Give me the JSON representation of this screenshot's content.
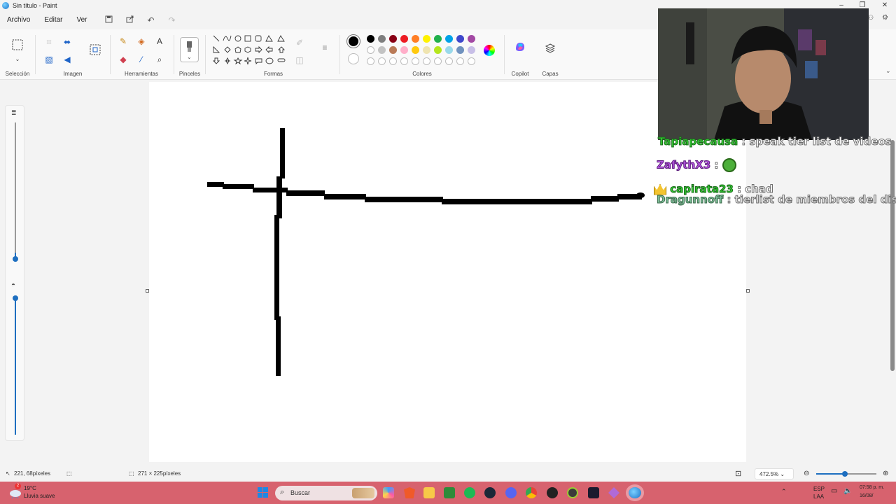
{
  "window": {
    "title": "Sin título - Paint"
  },
  "menu": {
    "items": [
      "Archivo",
      "Editar",
      "Ver"
    ]
  },
  "ribbon": {
    "groups": {
      "selection": "Selección",
      "image": "Imagen",
      "tools": "Herramientas",
      "brushes": "Pinceles",
      "shapes": "Formas",
      "colors": "Colores",
      "copilot": "Copilot",
      "layers": "Capas"
    },
    "palette_row1": [
      "#000000",
      "#7f7f7f",
      "#880015",
      "#ed1c24",
      "#ff7f27",
      "#fff200",
      "#22b14c",
      "#00a2e8",
      "#3f48cc",
      "#a349a4"
    ],
    "palette_row2": [
      "#ffffff",
      "#c3c3c3",
      "#b97a57",
      "#ffaec9",
      "#ffc90e",
      "#efe4b0",
      "#b5e61d",
      "#99d9ea",
      "#7092be",
      "#c8bfe7"
    ],
    "active_color": "#000000"
  },
  "chat": {
    "lines": [
      {
        "name": "Tapiapecausa",
        "msg": ": speak tier list de videos",
        "name_color": "#33cc33"
      },
      {
        "name": "ZafythX3",
        "msg": ":",
        "name_color": "#b455e0"
      },
      {
        "name": "capirata23",
        "msg": ": chad",
        "name_color": "#33cc33"
      },
      {
        "name": "Dragunnoff",
        "msg": ": tierlist de miembros del dis",
        "name_color": "#7fbf9a"
      }
    ]
  },
  "status": {
    "cursor": "221, 68píxeles",
    "selection": "271 × 225píxeles",
    "zoom": "472.5%"
  },
  "taskbar": {
    "weather_temp": "19°C",
    "weather_desc": "Lluvia suave",
    "weather_badge": "2",
    "search_placeholder": "Buscar",
    "lang_top": "ESP",
    "lang_bottom": "LAA",
    "time": "07:58 p. m.",
    "date": "16/08/"
  }
}
